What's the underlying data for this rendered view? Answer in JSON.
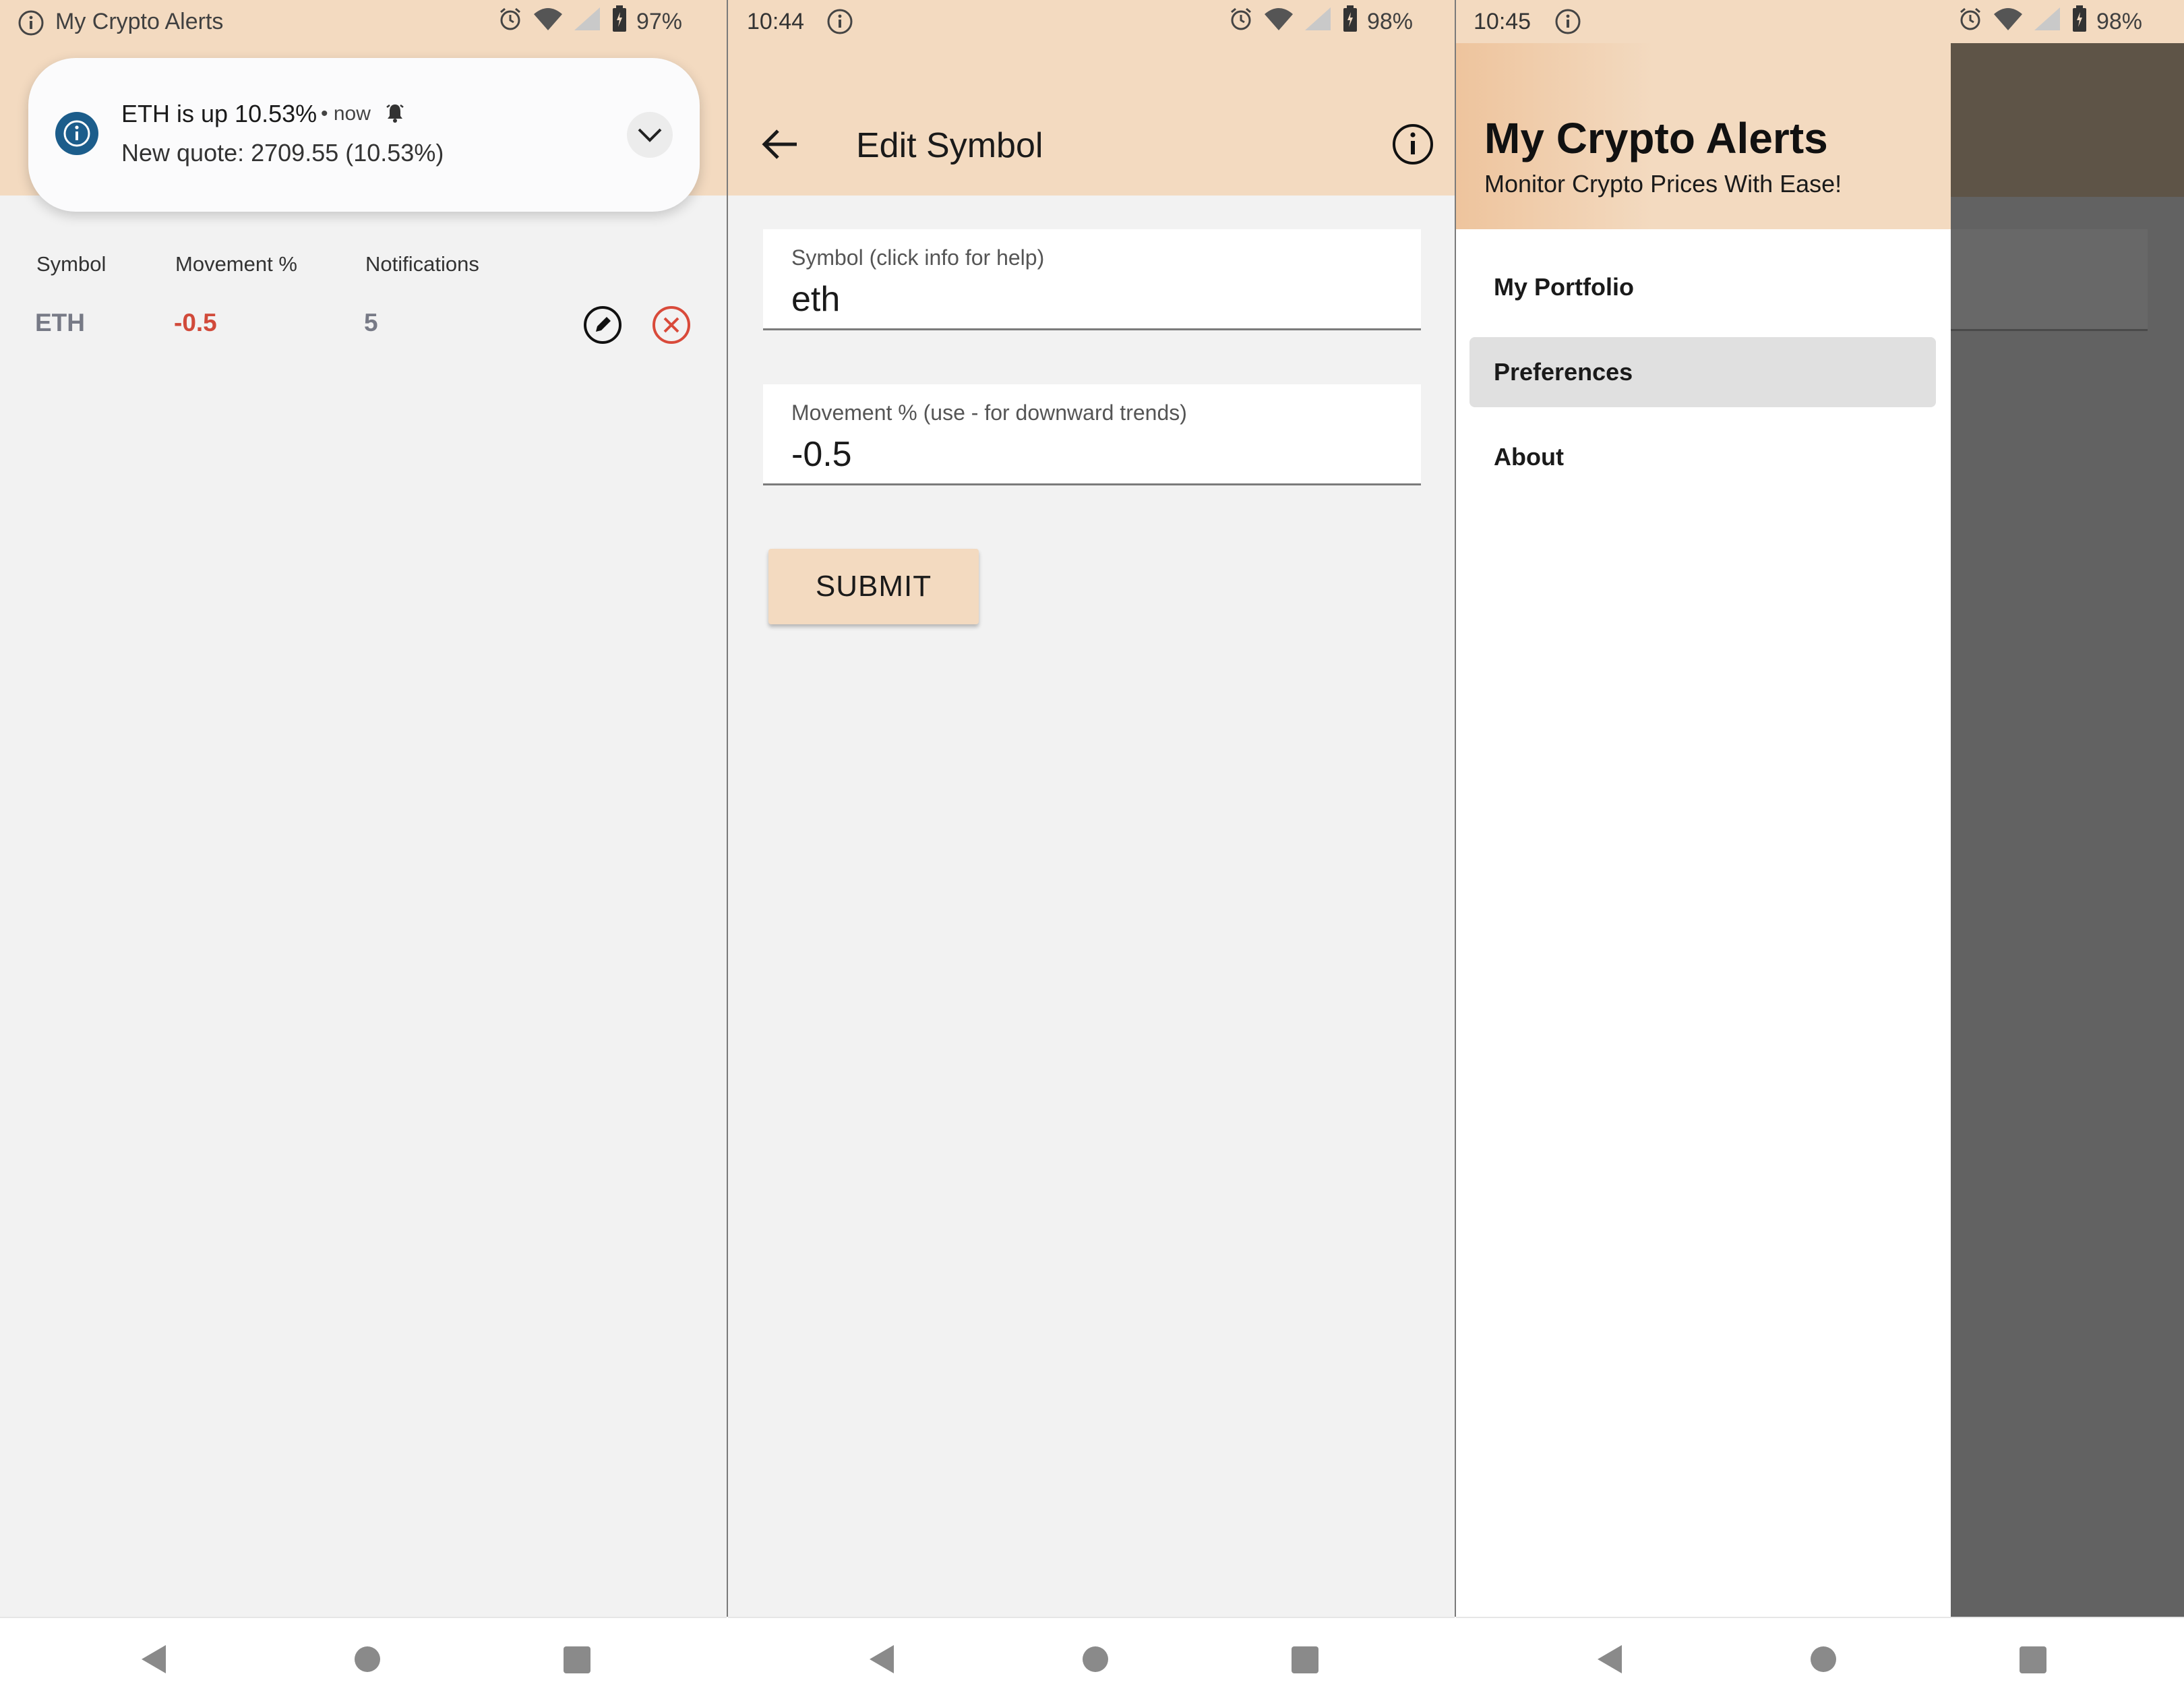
{
  "panel1": {
    "status": {
      "app_label": "My Crypto Alerts",
      "battery": "97%"
    },
    "notification": {
      "title": "ETH is up 10.53%",
      "meta": "• now",
      "body": "New quote: 2709.55 (10.53%)"
    },
    "table": {
      "headers": [
        "Symbol",
        "Movement %",
        "Notifications"
      ],
      "rows": [
        {
          "symbol": "ETH",
          "movement": "-0.5",
          "notifications": "5"
        }
      ]
    }
  },
  "panel2": {
    "status": {
      "time": "10:44",
      "battery": "98%"
    },
    "title": "Edit Symbol",
    "fields": {
      "symbol": {
        "label": "Symbol (click info for help)",
        "value": "eth"
      },
      "movement": {
        "label": "Movement % (use - for downward trends)",
        "value": "-0.5"
      }
    },
    "submit_label": "SUBMIT"
  },
  "panel3": {
    "status": {
      "time": "10:45",
      "battery": "98%"
    },
    "drawer": {
      "title": "My Crypto Alerts",
      "subtitle": "Monitor Crypto Prices With Ease!",
      "items": [
        {
          "label": "My Portfolio",
          "active": false
        },
        {
          "label": "Preferences",
          "active": true
        },
        {
          "label": "About",
          "active": false
        }
      ]
    }
  },
  "colors": {
    "header": "#f3dac0",
    "negative": "#d14a3a",
    "notif_icon": "#1c5d8b"
  },
  "icons": [
    "info-icon",
    "alarm-icon",
    "wifi-icon",
    "signal-icon",
    "battery-icon",
    "chevron-down-icon",
    "edit-icon",
    "delete-icon",
    "back-arrow-icon",
    "bell-icon"
  ]
}
